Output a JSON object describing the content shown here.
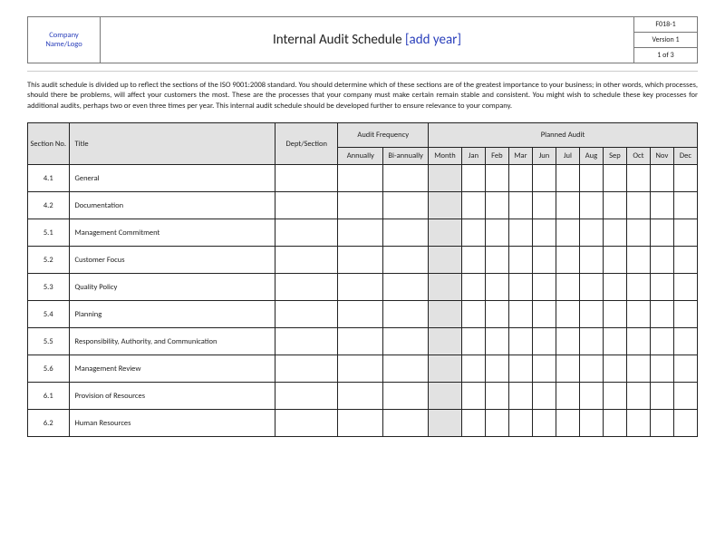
{
  "header": {
    "logo_text": "Company Name/Logo",
    "title_prefix": "Internal Audit Schedule ",
    "title_year": "[add year]",
    "form_no": "F018-1",
    "version": "Version 1",
    "page": "1 of 3"
  },
  "intro": "This audit schedule is divided up to reflect the sections of the ISO 9001:2008 standard. You should determine which of these sections are of the greatest importance to your business; in other words, which processes, should there be problems, will affect your customers the most. These are the processes that your company must make certain remain stable and consistent. You might wish to schedule these key processes for additional audits, perhaps two or even three times per year. This internal audit schedule should be developed further to ensure relevance to your company.",
  "columns": {
    "section_no": "Section No.",
    "title": "Title",
    "dept": "Dept/Section",
    "audit_freq": "Audit Frequency",
    "planned_audit": "Planned Audit",
    "annually": "Annually",
    "bi_annually": "Bi-annually",
    "month": "Month",
    "months": [
      "Jan",
      "Feb",
      "Mar",
      "Jun",
      "Jul",
      "Aug",
      "Sep",
      "Oct",
      "Nov",
      "Dec"
    ]
  },
  "rows": [
    {
      "section": "4.1",
      "title": "General"
    },
    {
      "section": "4.2",
      "title": "Documentation"
    },
    {
      "section": "5.1",
      "title": "Management Commitment"
    },
    {
      "section": "5.2",
      "title": "Customer Focus"
    },
    {
      "section": "5.3",
      "title": "Quality Policy"
    },
    {
      "section": "5.4",
      "title": "Planning"
    },
    {
      "section": "5.5",
      "title": "Responsibility, Authority, and Communication"
    },
    {
      "section": "5.6",
      "title": "Management Review"
    },
    {
      "section": "6.1",
      "title": "Provision of Resources"
    },
    {
      "section": "6.2",
      "title": "Human Resources"
    }
  ]
}
